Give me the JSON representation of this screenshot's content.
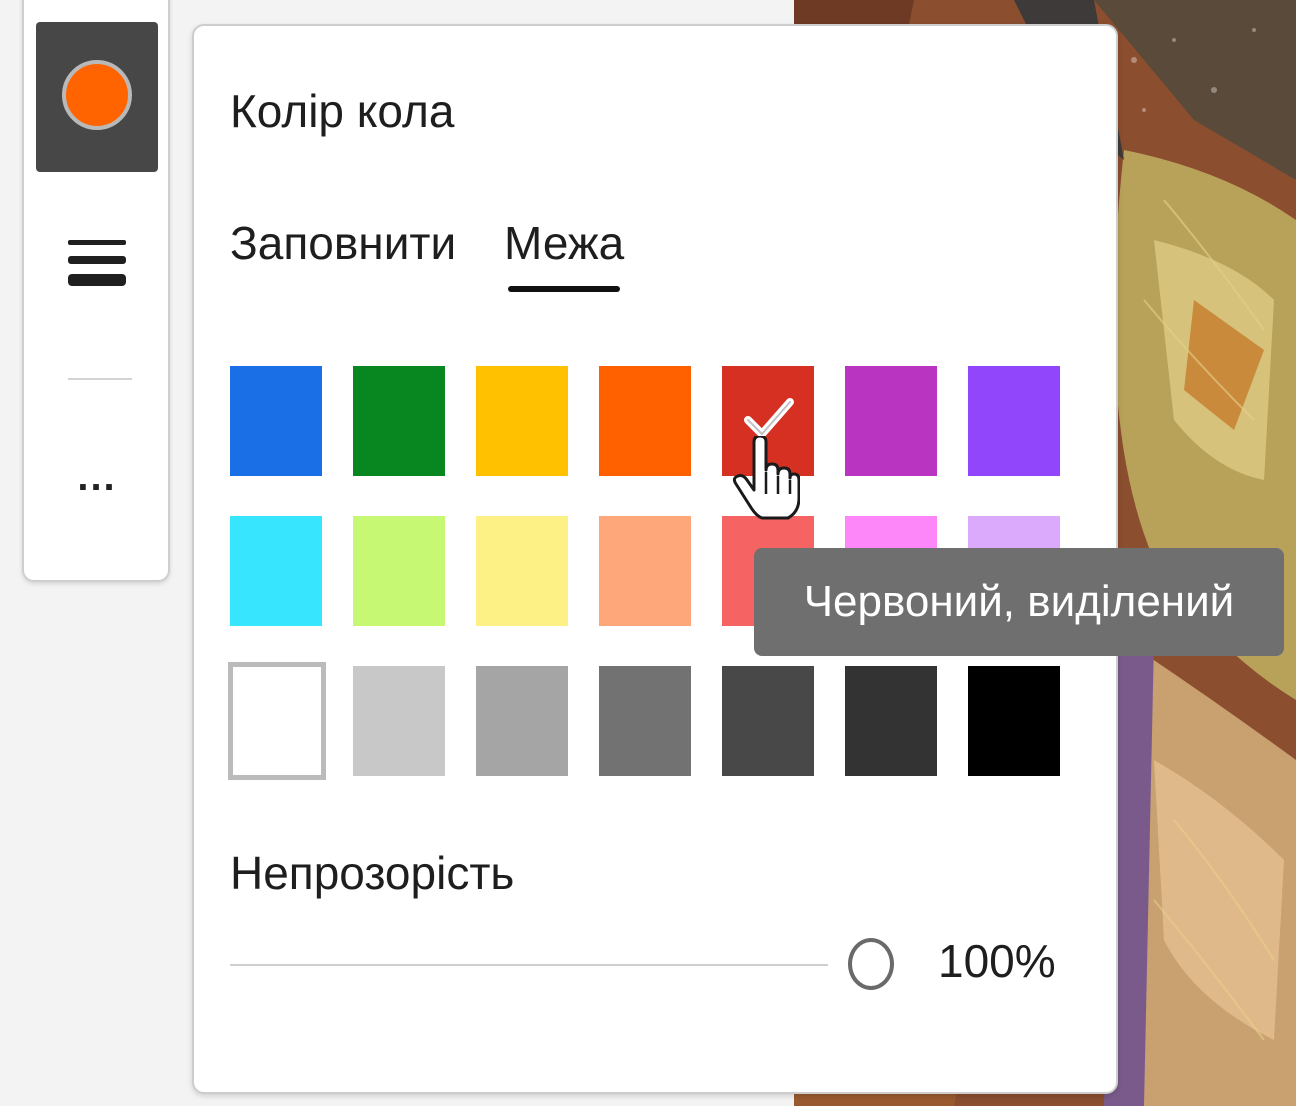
{
  "panel": {
    "title": "Колір кола",
    "tabs": [
      {
        "label": "Заповнити",
        "selected": false
      },
      {
        "label": "Межа",
        "selected": true
      }
    ],
    "palette": [
      [
        {
          "color": "#1a6fe6"
        },
        {
          "color": "#088720"
        },
        {
          "color": "#ffc100"
        },
        {
          "color": "#ff6000"
        },
        {
          "color": "#d63023",
          "selected": true
        },
        {
          "color": "#b934c0"
        },
        {
          "color": "#9146fb"
        }
      ],
      [
        {
          "color": "#38e5fe"
        },
        {
          "color": "#c7f873"
        },
        {
          "color": "#fdf186"
        },
        {
          "color": "#fea77a"
        },
        {
          "color": "#f66363"
        },
        {
          "color": "#fd86f9"
        },
        {
          "color": "#dbaafc"
        }
      ],
      [
        {
          "color": "#ffffff"
        },
        {
          "color": "#c8c8c8"
        },
        {
          "color": "#a5a5a5"
        },
        {
          "color": "#727272"
        },
        {
          "color": "#484848"
        },
        {
          "color": "#333333"
        },
        {
          "color": "#000000"
        }
      ]
    ],
    "opacity_label": "Непрозорість",
    "opacity_value": "100%",
    "opacity_fraction": 1.0
  },
  "tooltip": {
    "text": "Червоний, виділений"
  },
  "toolbar": {
    "current_color": "#ff6400",
    "more_label": "..."
  }
}
